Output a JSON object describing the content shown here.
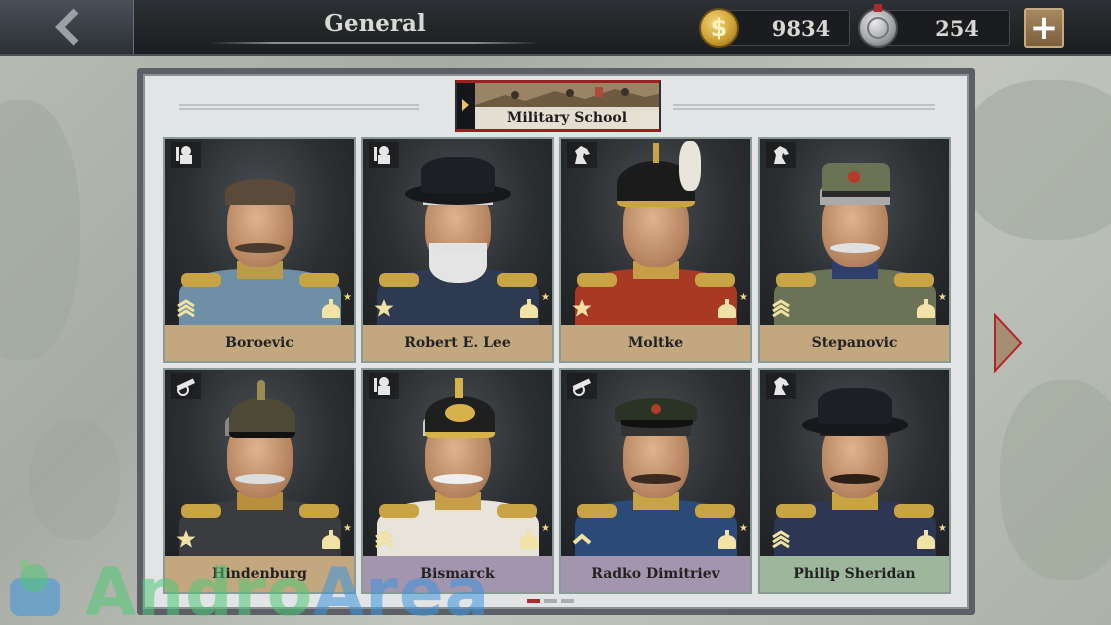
{
  "header": {
    "title": "General",
    "gold_amount": "9834",
    "medal_amount": "254",
    "back_icon": "chevron-left-icon",
    "gold_icon": "gold-coin-icon",
    "medal_icon": "medal-icon",
    "add_icon": "plus-icon",
    "gold_symbol": "$",
    "add_symbol": "+"
  },
  "panel": {
    "tab_label": "Military School",
    "generals": [
      {
        "name": "Boroevic",
        "branch": "infantry",
        "name_color": "tan"
      },
      {
        "name": "Robert E. Lee",
        "branch": "infantry",
        "name_color": "tan"
      },
      {
        "name": "Moltke",
        "branch": "cavalry",
        "name_color": "tan"
      },
      {
        "name": "Stepanovic",
        "branch": "cavalry",
        "name_color": "tan"
      },
      {
        "name": "Hindenburg",
        "branch": "artillery",
        "name_color": "tan"
      },
      {
        "name": "Bismarck",
        "branch": "infantry",
        "name_color": "purple"
      },
      {
        "name": "Radko Dimitriev",
        "branch": "artillery",
        "name_color": "purple"
      },
      {
        "name": "Philip Sheridan",
        "branch": "cavalry",
        "name_color": "green"
      }
    ],
    "pagination": {
      "pages": 3,
      "current": 1
    }
  },
  "watermark": {
    "part1": "Andro",
    "part2": "Area"
  },
  "colors": {
    "name_tan": "#c3a77e",
    "name_purple": "#a495ae",
    "name_green": "#9db79c",
    "accent_red": "#b3282a"
  }
}
